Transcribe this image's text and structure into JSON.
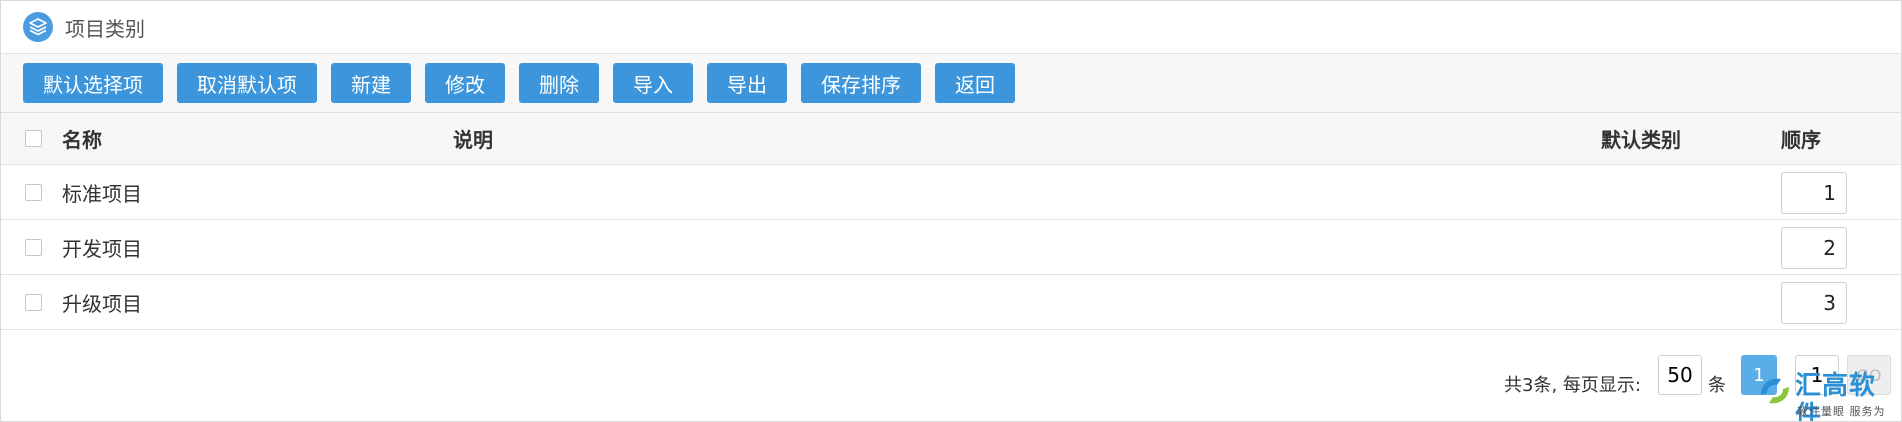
{
  "panel": {
    "title": "项目类别",
    "icon": "layers-icon"
  },
  "toolbar": {
    "buttons": [
      {
        "label": "默认选择项"
      },
      {
        "label": "取消默认项"
      },
      {
        "label": "新建"
      },
      {
        "label": "修改"
      },
      {
        "label": "删除"
      },
      {
        "label": "导入"
      },
      {
        "label": "导出"
      },
      {
        "label": "保存排序"
      },
      {
        "label": "返回"
      }
    ]
  },
  "table": {
    "columns": {
      "name": "名称",
      "desc": "说明",
      "default": "默认类别",
      "order": "顺序"
    },
    "rows": [
      {
        "name": "标准项目",
        "desc": "",
        "default": "",
        "order": "1"
      },
      {
        "name": "开发项目",
        "desc": "",
        "default": "",
        "order": "2"
      },
      {
        "name": "升级项目",
        "desc": "",
        "default": "",
        "order": "3"
      }
    ]
  },
  "pager": {
    "summary": "共3条, 每页显示:",
    "page_size": "50",
    "unit": "条",
    "current_page": "1",
    "goto_value": "1",
    "go_label": "GO"
  },
  "watermark": {
    "name": "汇高软件",
    "slogan": "软件量眼  服务为本"
  },
  "colors": {
    "accent": "#3d96db",
    "header_bg": "#f7f7f7",
    "border": "#e2e2e2"
  }
}
